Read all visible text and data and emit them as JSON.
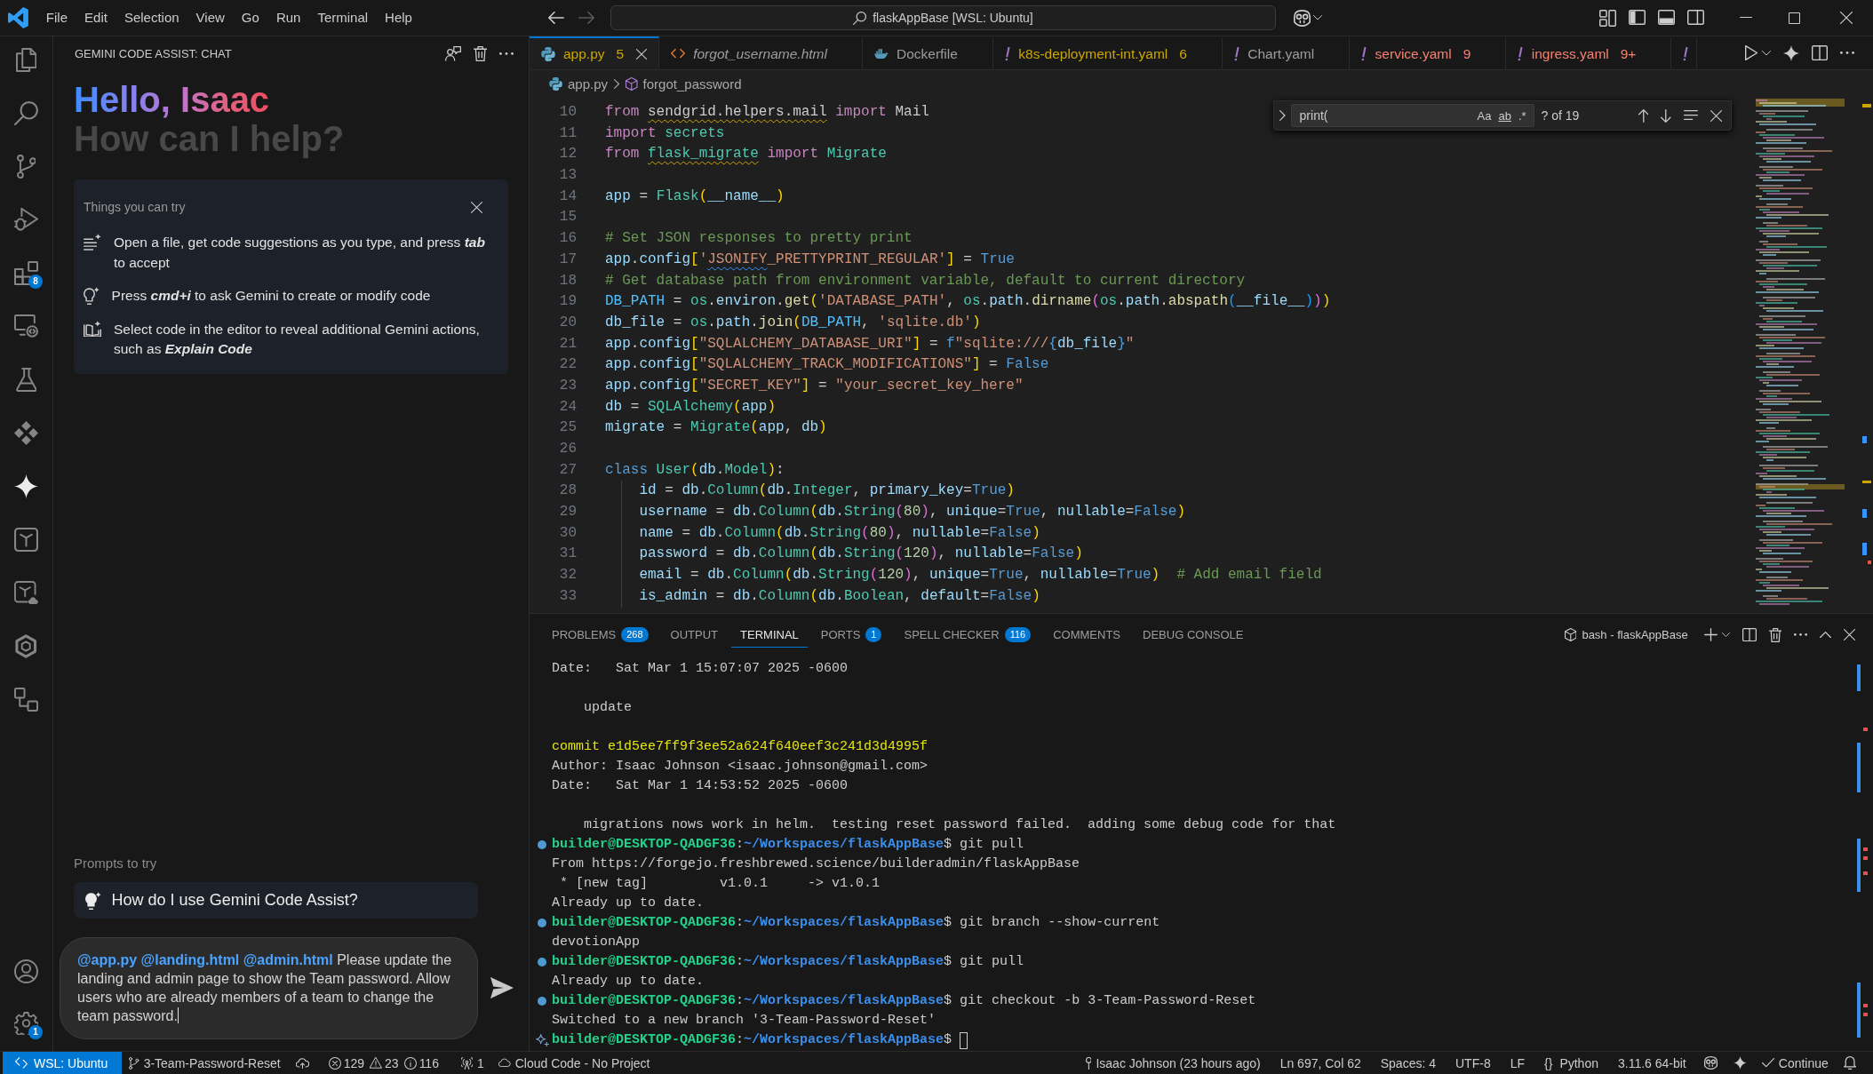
{
  "titlebar": {
    "menu": [
      "File",
      "Edit",
      "Selection",
      "View",
      "Go",
      "Run",
      "Terminal",
      "Help"
    ],
    "nav": [
      {
        "kind": "back",
        "disabled": false
      },
      {
        "kind": "forward",
        "disabled": true
      }
    ],
    "search": "flaskAppBase [WSL: Ubuntu]"
  },
  "activity_bar": {
    "items": [
      {
        "kind": "explorer",
        "selected": false
      },
      {
        "kind": "search",
        "selected": false
      },
      {
        "kind": "source_control",
        "selected": false
      },
      {
        "kind": "run_debug",
        "selected": false
      },
      {
        "kind": "extensions",
        "selected": false,
        "badge": "8"
      },
      {
        "kind": "remote",
        "selected": false
      },
      {
        "kind": "testing",
        "selected": false
      },
      {
        "kind": "diamonds",
        "selected": false
      },
      {
        "kind": "gemini",
        "selected": true
      },
      {
        "kind": "tile",
        "selected": false
      },
      {
        "kind": "tile_cloud",
        "selected": false
      },
      {
        "kind": "hexagon",
        "selected": false
      },
      {
        "kind": "diagram",
        "selected": false
      }
    ],
    "bottom": [
      {
        "kind": "account"
      },
      {
        "kind": "settings",
        "badge": "1"
      }
    ]
  },
  "sidebar": {
    "title": "GEMINI CODE ASSIST: CHAT",
    "greeting": "Hello, Isaac",
    "subtitle": "How can I help?",
    "tips": {
      "title": "Things you can try",
      "items": [
        {
          "kind": "lines",
          "text": "Open a file, get code suggestions as you type, and press **tab** to accept"
        },
        {
          "kind": "bulb",
          "text": "Press **cmd+i** to ask Gemini to create or modify code"
        },
        {
          "kind": "book",
          "text": "Select code in the editor to reveal additional Gemini actions, such as **Explain Code**"
        }
      ]
    },
    "prompts_label": "Prompts to try",
    "prompts": [
      "How do I use Gemini Code Assist?"
    ],
    "input": {
      "value": "**@app.py @landing.html @admin.html** Please update the landing and admin page to show the Team password. Allow users who are already members of a team to change the team password.",
      "focused": true
    }
  },
  "editor": {
    "tabs": [
      {
        "kind": "python",
        "label": "app.py",
        "color": "#cca700",
        "problems": "5",
        "selected": true,
        "preview": false
      },
      {
        "kind": "html",
        "label": "forgot_username.html",
        "selected": false,
        "preview": true
      },
      {
        "kind": "docker",
        "label": "Dockerfile",
        "selected": false,
        "preview": false
      },
      {
        "kind": "yaml",
        "label": "k8s-deployment-int.yaml",
        "color": "#cca700",
        "problems": "6",
        "selected": false,
        "preview": false
      },
      {
        "kind": "yaml",
        "label": "Chart.yaml",
        "selected": false,
        "preview": false
      },
      {
        "kind": "yaml",
        "label": "service.yaml",
        "color": "#f88070",
        "problems": "9",
        "selected": false,
        "preview": false
      },
      {
        "kind": "yaml",
        "label": "ingress.yaml",
        "color": "#f88070",
        "problems": "9+",
        "selected": false,
        "preview": false
      },
      {
        "kind": "yaml",
        "selected": false
      }
    ],
    "breadcrumbs": [
      {
        "kind": "python",
        "label": "app.py"
      },
      {
        "kind": "symbol",
        "label": "forgot_password"
      }
    ],
    "find": {
      "query": "print(",
      "toggles": [
        {
          "kind": "case",
          "label": "Aa"
        },
        {
          "kind": "word",
          "label": "ab"
        },
        {
          "kind": "regex",
          "label": ".*"
        }
      ],
      "result": "? of 19"
    },
    "lines": [
      {
        "number": "10",
        "tokens": [
          {
            "kind": "kw",
            "text": "from "
          },
          {
            "kind": "flagged",
            "text": "sendgrid.helpers.mail"
          },
          {
            "kind": "kw",
            "text": " import"
          },
          {
            "kind": "p",
            "text": " Mail"
          }
        ]
      },
      {
        "number": "11",
        "tokens": [
          {
            "kind": "kw",
            "text": "import "
          },
          {
            "kind": "cls",
            "text": "secrets"
          }
        ]
      },
      {
        "number": "12",
        "tokens": [
          {
            "kind": "kw",
            "text": "from "
          },
          {
            "kind": "flaggedmodule",
            "text": "flask_migrate"
          },
          {
            "kind": "kw",
            "text": " import "
          },
          {
            "kind": "cls",
            "text": "Migrate"
          }
        ]
      },
      {
        "number": "13"
      },
      {
        "number": "14",
        "tokens": [
          {
            "kind": "var",
            "text": "app"
          },
          {
            "kind": "p",
            "text": " = "
          },
          {
            "kind": "cls",
            "text": "Flask"
          },
          {
            "kind": "b1",
            "text": "("
          },
          {
            "kind": "var",
            "text": "__name__"
          },
          {
            "kind": "b1",
            "text": ")"
          }
        ]
      },
      {
        "number": "15"
      },
      {
        "number": "16",
        "tokens": [
          {
            "kind": "com",
            "text": "# Set JSON responses to pretty print"
          }
        ]
      },
      {
        "number": "17",
        "tokens": [
          {
            "kind": "var",
            "text": "app"
          },
          {
            "kind": "p",
            "text": "."
          },
          {
            "kind": "var",
            "text": "config"
          },
          {
            "kind": "b1",
            "text": "["
          },
          {
            "kind": "str",
            "text": "'"
          },
          {
            "kind": "misspelled",
            "text": "JSONIFY"
          },
          {
            "kind": "str",
            "text": "_PRETTYPRINT_REGULAR'"
          },
          {
            "kind": "b1",
            "text": "]"
          },
          {
            "kind": "p",
            "text": " = "
          },
          {
            "kind": "con",
            "text": "True"
          }
        ]
      },
      {
        "number": "18",
        "tokens": [
          {
            "kind": "com",
            "text": "# Get database path from environment variable, default to current directory"
          }
        ]
      },
      {
        "number": "19",
        "tokens": [
          {
            "kind": "const",
            "text": "DB_PATH"
          },
          {
            "kind": "p",
            "text": " = "
          },
          {
            "kind": "cls",
            "text": "os"
          },
          {
            "kind": "p",
            "text": "."
          },
          {
            "kind": "var",
            "text": "environ"
          },
          {
            "kind": "p",
            "text": "."
          },
          {
            "kind": "fn",
            "text": "get"
          },
          {
            "kind": "b1",
            "text": "("
          },
          {
            "kind": "str",
            "text": "'DATABASE_PATH'"
          },
          {
            "kind": "p",
            "text": ", "
          },
          {
            "kind": "cls",
            "text": "os"
          },
          {
            "kind": "p",
            "text": "."
          },
          {
            "kind": "var",
            "text": "path"
          },
          {
            "kind": "p",
            "text": "."
          },
          {
            "kind": "fn",
            "text": "dirname"
          },
          {
            "kind": "b2",
            "text": "("
          },
          {
            "kind": "cls",
            "text": "os"
          },
          {
            "kind": "p",
            "text": "."
          },
          {
            "kind": "var",
            "text": "path"
          },
          {
            "kind": "p",
            "text": "."
          },
          {
            "kind": "fn",
            "text": "abspath"
          },
          {
            "kind": "b3",
            "text": "("
          },
          {
            "kind": "var",
            "text": "__file__"
          },
          {
            "kind": "b3",
            "text": ")"
          },
          {
            "kind": "b2",
            "text": ")"
          },
          {
            "kind": "b1",
            "text": ")"
          }
        ]
      },
      {
        "number": "20",
        "tokens": [
          {
            "kind": "var",
            "text": "db_file"
          },
          {
            "kind": "p",
            "text": " = "
          },
          {
            "kind": "cls",
            "text": "os"
          },
          {
            "kind": "p",
            "text": "."
          },
          {
            "kind": "var",
            "text": "path"
          },
          {
            "kind": "p",
            "text": "."
          },
          {
            "kind": "fn",
            "text": "join"
          },
          {
            "kind": "b1",
            "text": "("
          },
          {
            "kind": "const",
            "text": "DB_PATH"
          },
          {
            "kind": "p",
            "text": ", "
          },
          {
            "kind": "str",
            "text": "'sqlite.db'"
          },
          {
            "kind": "b1",
            "text": ")"
          }
        ]
      },
      {
        "number": "21",
        "tokens": [
          {
            "kind": "var",
            "text": "app"
          },
          {
            "kind": "p",
            "text": "."
          },
          {
            "kind": "var",
            "text": "config"
          },
          {
            "kind": "b1",
            "text": "["
          },
          {
            "kind": "str",
            "text": "\"SQLALCHEMY_DATABASE_URI\""
          },
          {
            "kind": "b1",
            "text": "]"
          },
          {
            "kind": "p",
            "text": " = "
          },
          {
            "kind": "st",
            "text": "f"
          },
          {
            "kind": "str",
            "text": "\"sqlite:///"
          },
          {
            "kind": "st",
            "text": "{"
          },
          {
            "kind": "var",
            "text": "db_file"
          },
          {
            "kind": "st",
            "text": "}"
          },
          {
            "kind": "str",
            "text": "\""
          }
        ]
      },
      {
        "number": "22",
        "tokens": [
          {
            "kind": "var",
            "text": "app"
          },
          {
            "kind": "p",
            "text": "."
          },
          {
            "kind": "var",
            "text": "config"
          },
          {
            "kind": "b1",
            "text": "["
          },
          {
            "kind": "str",
            "text": "\"SQLALCHEMY_TRACK_MODIFICATIONS\""
          },
          {
            "kind": "b1",
            "text": "]"
          },
          {
            "kind": "p",
            "text": " = "
          },
          {
            "kind": "con",
            "text": "False"
          }
        ]
      },
      {
        "number": "23",
        "tokens": [
          {
            "kind": "var",
            "text": "app"
          },
          {
            "kind": "p",
            "text": "."
          },
          {
            "kind": "var",
            "text": "config"
          },
          {
            "kind": "b1",
            "text": "["
          },
          {
            "kind": "str",
            "text": "\"SECRET_KEY\""
          },
          {
            "kind": "b1",
            "text": "]"
          },
          {
            "kind": "p",
            "text": " = "
          },
          {
            "kind": "str",
            "text": "\"your_secret_key_here\""
          }
        ]
      },
      {
        "number": "24",
        "tokens": [
          {
            "kind": "var",
            "text": "db"
          },
          {
            "kind": "p",
            "text": " = "
          },
          {
            "kind": "cls",
            "text": "SQLAlchemy"
          },
          {
            "kind": "b1",
            "text": "("
          },
          {
            "kind": "var",
            "text": "app"
          },
          {
            "kind": "b1",
            "text": ")"
          }
        ]
      },
      {
        "number": "25",
        "tokens": [
          {
            "kind": "var",
            "text": "migrate"
          },
          {
            "kind": "p",
            "text": " = "
          },
          {
            "kind": "cls",
            "text": "Migrate"
          },
          {
            "kind": "b1",
            "text": "("
          },
          {
            "kind": "var",
            "text": "app"
          },
          {
            "kind": "p",
            "text": ", "
          },
          {
            "kind": "var",
            "text": "db"
          },
          {
            "kind": "b1",
            "text": ")"
          }
        ]
      },
      {
        "number": "26"
      },
      {
        "number": "27",
        "tokens": [
          {
            "kind": "st",
            "text": "class "
          },
          {
            "kind": "cls",
            "text": "User"
          },
          {
            "kind": "b1",
            "text": "("
          },
          {
            "kind": "var",
            "text": "db"
          },
          {
            "kind": "p",
            "text": "."
          },
          {
            "kind": "cls",
            "text": "Model"
          },
          {
            "kind": "b1",
            "text": ")"
          },
          {
            "kind": "p",
            "text": ":"
          }
        ]
      },
      {
        "number": "28",
        "tokens": [
          {
            "kind": "var",
            "text": "    id"
          },
          {
            "kind": "p",
            "text": " = "
          },
          {
            "kind": "var",
            "text": "db"
          },
          {
            "kind": "p",
            "text": "."
          },
          {
            "kind": "cls",
            "text": "Column"
          },
          {
            "kind": "b1",
            "text": "("
          },
          {
            "kind": "var",
            "text": "db"
          },
          {
            "kind": "p",
            "text": "."
          },
          {
            "kind": "cls",
            "text": "Integer"
          },
          {
            "kind": "p",
            "text": ", "
          },
          {
            "kind": "var",
            "text": "primary_key"
          },
          {
            "kind": "p",
            "text": "="
          },
          {
            "kind": "con",
            "text": "True"
          },
          {
            "kind": "b1",
            "text": ")"
          }
        ]
      },
      {
        "number": "29",
        "tokens": [
          {
            "kind": "var",
            "text": "    username"
          },
          {
            "kind": "p",
            "text": " = "
          },
          {
            "kind": "var",
            "text": "db"
          },
          {
            "kind": "p",
            "text": "."
          },
          {
            "kind": "cls",
            "text": "Column"
          },
          {
            "kind": "b1",
            "text": "("
          },
          {
            "kind": "var",
            "text": "db"
          },
          {
            "kind": "p",
            "text": "."
          },
          {
            "kind": "cls",
            "text": "String"
          },
          {
            "kind": "b2",
            "text": "("
          },
          {
            "kind": "num",
            "text": "80"
          },
          {
            "kind": "b2",
            "text": ")"
          },
          {
            "kind": "p",
            "text": ", "
          },
          {
            "kind": "var",
            "text": "unique"
          },
          {
            "kind": "p",
            "text": "="
          },
          {
            "kind": "con",
            "text": "True"
          },
          {
            "kind": "p",
            "text": ", "
          },
          {
            "kind": "var",
            "text": "nullable"
          },
          {
            "kind": "p",
            "text": "="
          },
          {
            "kind": "con",
            "text": "False"
          },
          {
            "kind": "b1",
            "text": ")"
          }
        ]
      },
      {
        "number": "30",
        "tokens": [
          {
            "kind": "var",
            "text": "    name"
          },
          {
            "kind": "p",
            "text": " = "
          },
          {
            "kind": "var",
            "text": "db"
          },
          {
            "kind": "p",
            "text": "."
          },
          {
            "kind": "cls",
            "text": "Column"
          },
          {
            "kind": "b1",
            "text": "("
          },
          {
            "kind": "var",
            "text": "db"
          },
          {
            "kind": "p",
            "text": "."
          },
          {
            "kind": "cls",
            "text": "String"
          },
          {
            "kind": "b2",
            "text": "("
          },
          {
            "kind": "num",
            "text": "80"
          },
          {
            "kind": "b2",
            "text": ")"
          },
          {
            "kind": "p",
            "text": ", "
          },
          {
            "kind": "var",
            "text": "nullable"
          },
          {
            "kind": "p",
            "text": "="
          },
          {
            "kind": "con",
            "text": "False"
          },
          {
            "kind": "b1",
            "text": ")"
          }
        ]
      },
      {
        "number": "31",
        "tokens": [
          {
            "kind": "var",
            "text": "    password"
          },
          {
            "kind": "p",
            "text": " = "
          },
          {
            "kind": "var",
            "text": "db"
          },
          {
            "kind": "p",
            "text": "."
          },
          {
            "kind": "cls",
            "text": "Column"
          },
          {
            "kind": "b1",
            "text": "("
          },
          {
            "kind": "var",
            "text": "db"
          },
          {
            "kind": "p",
            "text": "."
          },
          {
            "kind": "cls",
            "text": "String"
          },
          {
            "kind": "b2",
            "text": "("
          },
          {
            "kind": "num",
            "text": "120"
          },
          {
            "kind": "b2",
            "text": ")"
          },
          {
            "kind": "p",
            "text": ", "
          },
          {
            "kind": "var",
            "text": "nullable"
          },
          {
            "kind": "p",
            "text": "="
          },
          {
            "kind": "con",
            "text": "False"
          },
          {
            "kind": "b1",
            "text": ")"
          }
        ]
      },
      {
        "number": "32",
        "tokens": [
          {
            "kind": "var",
            "text": "    email"
          },
          {
            "kind": "p",
            "text": " = "
          },
          {
            "kind": "var",
            "text": "db"
          },
          {
            "kind": "p",
            "text": "."
          },
          {
            "kind": "cls",
            "text": "Column"
          },
          {
            "kind": "b1",
            "text": "("
          },
          {
            "kind": "var",
            "text": "db"
          },
          {
            "kind": "p",
            "text": "."
          },
          {
            "kind": "cls",
            "text": "String"
          },
          {
            "kind": "b2",
            "text": "("
          },
          {
            "kind": "num",
            "text": "120"
          },
          {
            "kind": "b2",
            "text": ")"
          },
          {
            "kind": "p",
            "text": ", "
          },
          {
            "kind": "var",
            "text": "unique"
          },
          {
            "kind": "p",
            "text": "="
          },
          {
            "kind": "con",
            "text": "True"
          },
          {
            "kind": "p",
            "text": ", "
          },
          {
            "kind": "var",
            "text": "nullable"
          },
          {
            "kind": "p",
            "text": "="
          },
          {
            "kind": "con",
            "text": "True"
          },
          {
            "kind": "b1",
            "text": ")"
          },
          {
            "kind": "com",
            "text": "  # Add email field"
          }
        ]
      },
      {
        "number": "33",
        "tokens": [
          {
            "kind": "var",
            "text": "    is_admin"
          },
          {
            "kind": "p",
            "text": " = "
          },
          {
            "kind": "var",
            "text": "db"
          },
          {
            "kind": "p",
            "text": "."
          },
          {
            "kind": "cls",
            "text": "Column"
          },
          {
            "kind": "b1",
            "text": "("
          },
          {
            "kind": "var",
            "text": "db"
          },
          {
            "kind": "p",
            "text": "."
          },
          {
            "kind": "cls",
            "text": "Boolean"
          },
          {
            "kind": "p",
            "text": ", "
          },
          {
            "kind": "var",
            "text": "default"
          },
          {
            "kind": "p",
            "text": "="
          },
          {
            "kind": "con",
            "text": "False"
          },
          {
            "kind": "b1",
            "text": ")"
          }
        ]
      }
    ]
  },
  "panel": {
    "tabs": [
      {
        "label": "PROBLEMS",
        "count": "268",
        "selected": false
      },
      {
        "label": "OUTPUT",
        "selected": false
      },
      {
        "label": "TERMINAL",
        "selected": true
      },
      {
        "label": "PORTS",
        "count": "1",
        "selected": false
      },
      {
        "label": "SPELL CHECKER",
        "count": "116",
        "selected": false
      },
      {
        "label": "COMMENTS",
        "selected": false
      },
      {
        "label": "DEBUG CONSOLE",
        "selected": false
      }
    ],
    "terminal": {
      "title": "bash - flaskAppBase",
      "lines": [
        {
          "kind": "text",
          "text": "Date:   Sat Mar 1 15:07:07 2025 -0600"
        },
        {
          "kind": "blank"
        },
        {
          "kind": "text",
          "text": "    update"
        },
        {
          "kind": "blank"
        },
        {
          "kind": "commit",
          "text": "commit e1d5ee7ff9f3ee52a624f640eef3c241d3d4995f"
        },
        {
          "kind": "text",
          "text": "Author: Isaac Johnson <isaac.johnson@gmail.com>"
        },
        {
          "kind": "text",
          "text": "Date:   Sat Mar 1 14:53:52 2025 -0600"
        },
        {
          "kind": "blank"
        },
        {
          "kind": "text",
          "text": "    migrations nows work in helm.  testing reset password failed.  adding some debug code for that"
        },
        {
          "kind": "command",
          "user": "builder@DESKTOP-QADGF36",
          "separator": ":",
          "path": "~/Workspaces/flaskAppBase",
          "command": "$ git pull"
        },
        {
          "kind": "text",
          "text": "From https://forgejo.freshbrewed.science/builderadmin/flaskAppBase"
        },
        {
          "kind": "text",
          "text": " * [new tag]         v1.0.1     -> v1.0.1"
        },
        {
          "kind": "text",
          "text": "Already up to date."
        },
        {
          "kind": "command",
          "user": "builder@DESKTOP-QADGF36",
          "separator": ":",
          "path": "~/Workspaces/flaskAppBase",
          "command": "$ git branch --show-current"
        },
        {
          "kind": "text",
          "text": "devotionApp"
        },
        {
          "kind": "command",
          "user": "builder@DESKTOP-QADGF36",
          "separator": ":",
          "path": "~/Workspaces/flaskAppBase",
          "command": "$ git pull"
        },
        {
          "kind": "text",
          "text": "Already up to date."
        },
        {
          "kind": "command",
          "user": "builder@DESKTOP-QADGF36",
          "separator": ":",
          "path": "~/Workspaces/flaskAppBase",
          "command": "$ git checkout -b 3-Team-Password-Reset"
        },
        {
          "kind": "text",
          "text": "Switched to a new branch '3-Team-Password-Reset'"
        },
        {
          "kind": "current",
          "user": "builder@DESKTOP-QADGF36",
          "separator": ":",
          "path": "~/Workspaces/flaskAppBase",
          "command": "$"
        }
      ]
    }
  },
  "status_bar": {
    "left": [
      {
        "kind": "remote",
        "label": "WSL: Ubuntu"
      },
      {
        "kind": "branch",
        "label": "3-Team-Password-Reset"
      },
      {
        "kind": "sync"
      },
      {
        "kind": "errors",
        "label": "129"
      },
      {
        "kind": "warnings",
        "label": "23"
      },
      {
        "kind": "info",
        "label": "116"
      },
      {
        "kind": "ports",
        "label": "1"
      },
      {
        "kind": "cloud",
        "label": "Cloud Code - No Project"
      }
    ],
    "right": [
      {
        "kind": "blame",
        "label": "Isaac Johnson (23 hours ago)"
      },
      {
        "kind": "text",
        "label": "Ln 697, Col 62"
      },
      {
        "kind": "text",
        "label": "Spaces: 4"
      },
      {
        "kind": "text",
        "label": "UTF-8"
      },
      {
        "kind": "text",
        "label": "LF"
      },
      {
        "kind": "language",
        "icon": "{}",
        "label": "Python"
      },
      {
        "kind": "text",
        "label": "3.11.6 64-bit"
      },
      {
        "kind": "assistant"
      },
      {
        "kind": "sparkle"
      },
      {
        "kind": "check",
        "label": "Continue"
      },
      {
        "kind": "bell"
      }
    ]
  }
}
